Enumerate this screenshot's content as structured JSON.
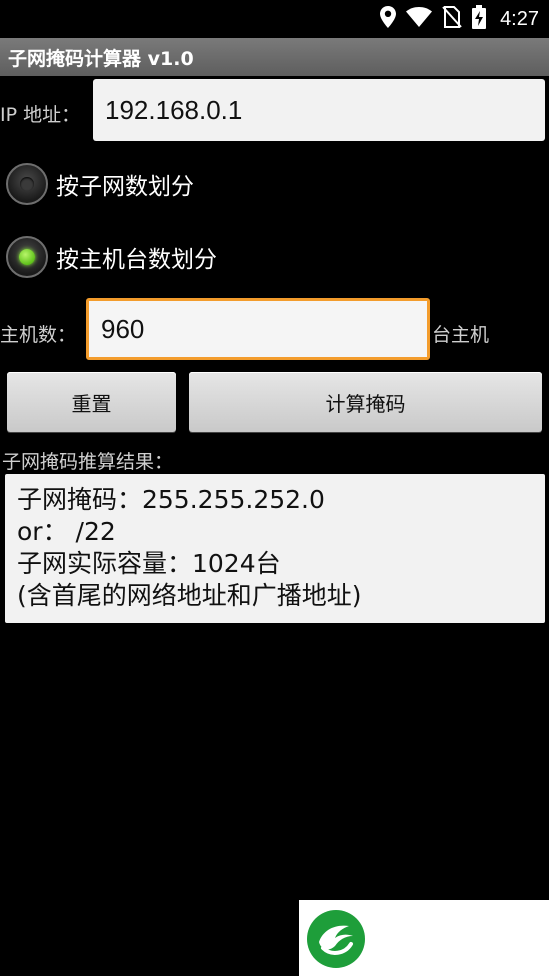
{
  "status_bar": {
    "time": "4:27",
    "icons": [
      "location-icon",
      "wifi-icon",
      "no-sim-icon",
      "battery-charging-icon"
    ]
  },
  "app": {
    "title": "子网掩码计算器 v1.0"
  },
  "ip": {
    "label": "IP 地址：",
    "value": "192.168.0.1"
  },
  "mode": {
    "options": [
      {
        "label": "按子网数划分",
        "selected": false
      },
      {
        "label": "按主机台数划分",
        "selected": true
      }
    ]
  },
  "hosts": {
    "label": "主机数：",
    "value": "960",
    "suffix": "台主机"
  },
  "buttons": {
    "reset": "重置",
    "calculate": "计算掩码"
  },
  "result": {
    "heading": "子网掩码推算结果：",
    "lines": [
      "子网掩码：255.255.252.0",
      "or： /22",
      "子网实际容量：1024台",
      "(含首尾的网络地址和广播地址)"
    ]
  },
  "colors": {
    "accent_focus": "#f39c2c",
    "radio_on": "#5fc21a",
    "watermark_green": "#1e9e3a"
  }
}
